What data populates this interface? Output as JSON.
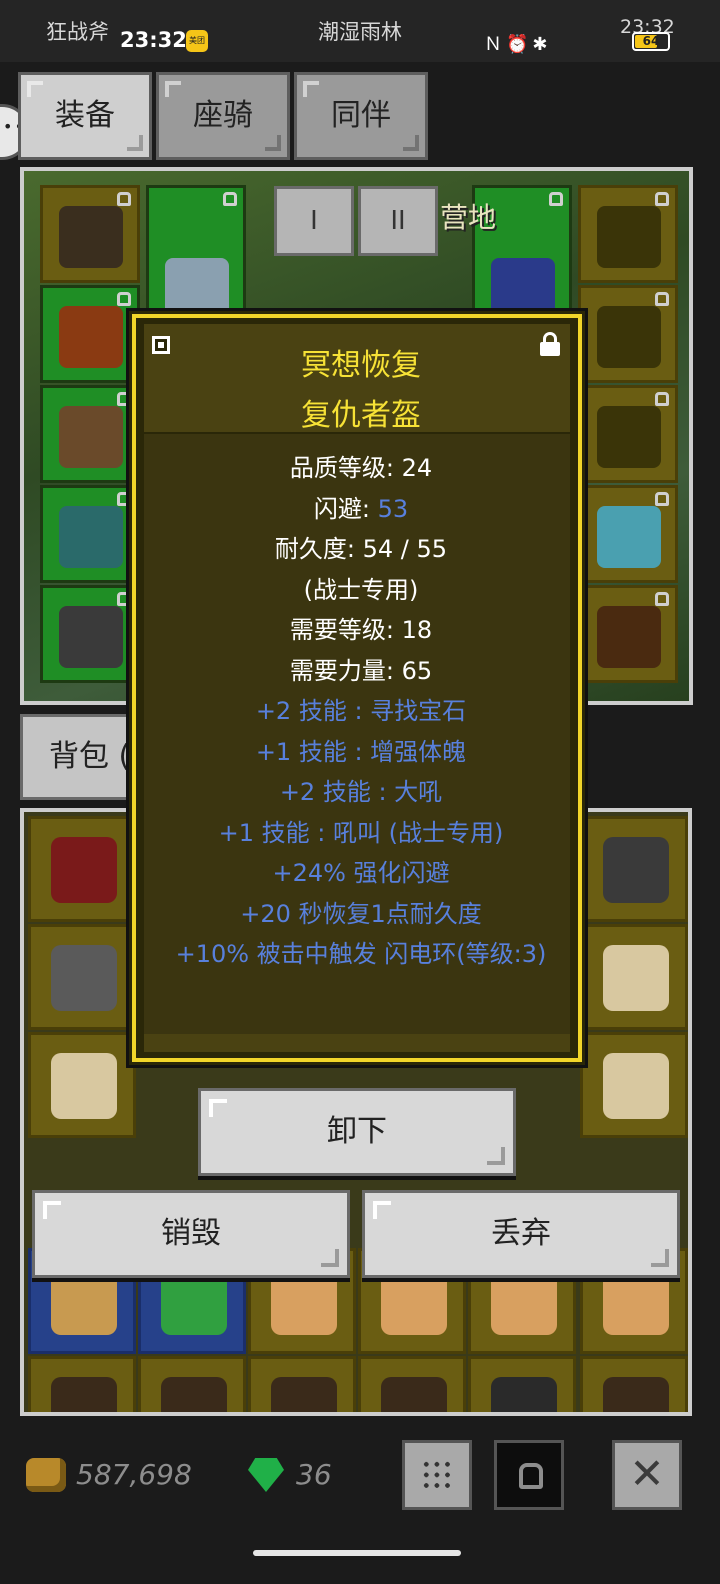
{
  "status_bar": {
    "app_name": "狂战斧",
    "time_left": "23:32",
    "notification_badge": "美团",
    "title": "潮湿雨林",
    "time_right": "23:32",
    "icons": [
      "nfc-icon",
      "alarm-icon",
      "bluetooth-icon",
      "hd-icon",
      "signal-icon"
    ],
    "battery": "64",
    "battery_level": 0.64
  },
  "tabs": [
    {
      "label": "装备",
      "active": true
    },
    {
      "label": "座骑",
      "active": false
    },
    {
      "label": "同伴",
      "active": false
    }
  ],
  "equipment": {
    "area_name": "营地",
    "pager": [
      "I",
      "II"
    ],
    "slots": [
      {
        "name": "gloves-slot",
        "color": "yellow",
        "icon_color": "#3a2e1e"
      },
      {
        "name": "sword-slot",
        "color": "green",
        "icon_color": "#8aa0b0"
      },
      {
        "name": "shield-slot",
        "color": "green",
        "icon_color": "#2a3a8a"
      },
      {
        "name": "necklace-slot",
        "color": "yellow",
        "icon_color": "#3a3408"
      },
      {
        "name": "armor-slot",
        "color": "green",
        "icon_color": "#8a3a12"
      },
      {
        "name": "ring-slot-1",
        "color": "yellow",
        "icon_color": "#3a3408"
      },
      {
        "name": "gauntlet-slot",
        "color": "green",
        "icon_color": "#6a4a2a"
      },
      {
        "name": "ring-slot-2",
        "color": "yellow",
        "icon_color": "#3a3408"
      },
      {
        "name": "boots-slot",
        "color": "green",
        "icon_color": "#2a6a6a"
      },
      {
        "name": "feather-slot",
        "color": "yellow",
        "icon_color": "#4aa0b0"
      },
      {
        "name": "helmet-slot",
        "color": "green",
        "icon_color": "#3a3a3a"
      },
      {
        "name": "charm-slot",
        "color": "yellow",
        "icon_color": "#4a2a10"
      }
    ]
  },
  "bag": {
    "tab_label": "背包 (",
    "slots_colors": [
      "#6a5d12",
      "#26418a"
    ]
  },
  "tooltip": {
    "name_line1": "冥想恢复",
    "name_line2": "复仇者盔",
    "lines": [
      {
        "prefix": "品质等级: ",
        "value": "24",
        "color": "white"
      },
      {
        "prefix": "闪避: ",
        "value": "53",
        "color": "mixed"
      },
      {
        "prefix": "耐久度: ",
        "value": "54 / 55",
        "color": "white"
      },
      {
        "prefix": "",
        "value": "(战士专用)",
        "color": "white"
      },
      {
        "prefix": "需要等级: ",
        "value": "18",
        "color": "white"
      },
      {
        "prefix": "需要力量: ",
        "value": "65",
        "color": "white"
      },
      {
        "prefix": "",
        "value": "+2 技能 : 寻找宝石",
        "color": "blue"
      },
      {
        "prefix": "",
        "value": "+1 技能 : 增强体魄",
        "color": "blue"
      },
      {
        "prefix": "",
        "value": "+2 技能 : 大吼",
        "color": "blue"
      },
      {
        "prefix": "",
        "value": "+1 技能 : 吼叫 (战士专用)",
        "color": "blue"
      },
      {
        "prefix": "",
        "value": "+24% 强化闪避",
        "color": "blue"
      },
      {
        "prefix": "",
        "value": "+20 秒恢复1点耐久度",
        "color": "blue"
      },
      {
        "prefix": "",
        "value": "+10% 被击中触发 闪电环(等级:3)",
        "color": "blue"
      }
    ]
  },
  "actions": {
    "unequip": "卸下",
    "destroy": "销毁",
    "discard": "丢弃"
  },
  "bottom_bar": {
    "gold": "587,698",
    "gems": "36",
    "buttons": [
      "grid-button",
      "lock-button",
      "close-button"
    ],
    "close_symbol": "✕"
  },
  "colors": {
    "tooltip_border": "#f1d52a",
    "tooltip_title": "#f7e236",
    "stat_blue": "#5880dc"
  }
}
